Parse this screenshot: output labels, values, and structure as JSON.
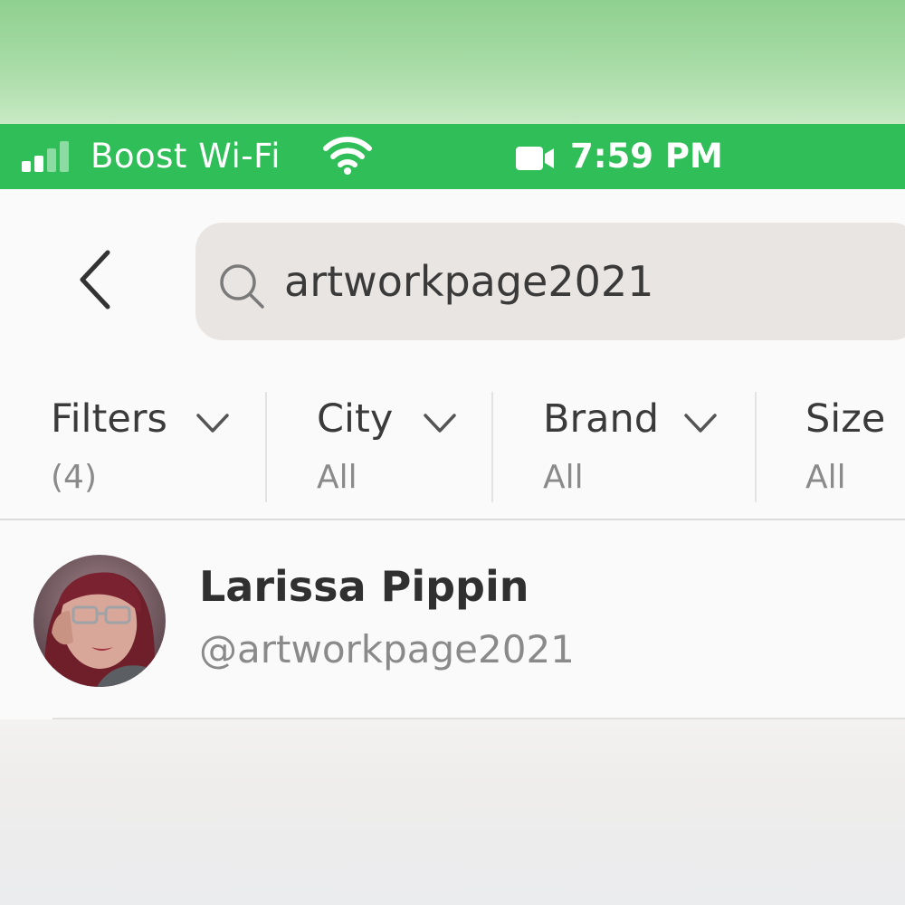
{
  "status_bar": {
    "carrier": "Boost Wi-Fi",
    "time": "7:59 PM",
    "background_color": "#2fbe57",
    "icons": [
      "signal-icon",
      "wifi-icon",
      "camera-icon"
    ]
  },
  "header": {
    "back_icon": "chevron-left-icon",
    "search": {
      "value": "artworkpage2021",
      "icon": "search-icon"
    }
  },
  "filters": [
    {
      "label": "Filters",
      "value": "(4)",
      "has_chevron": true
    },
    {
      "label": "City",
      "value": "All",
      "has_chevron": true
    },
    {
      "label": "Brand",
      "value": "All",
      "has_chevron": true
    },
    {
      "label": "Size",
      "value": "All",
      "has_chevron": false
    }
  ],
  "results": [
    {
      "name": "Larissa Pippin",
      "handle": "@artworkpage2021",
      "avatar_icon": "profile-photo"
    }
  ]
}
